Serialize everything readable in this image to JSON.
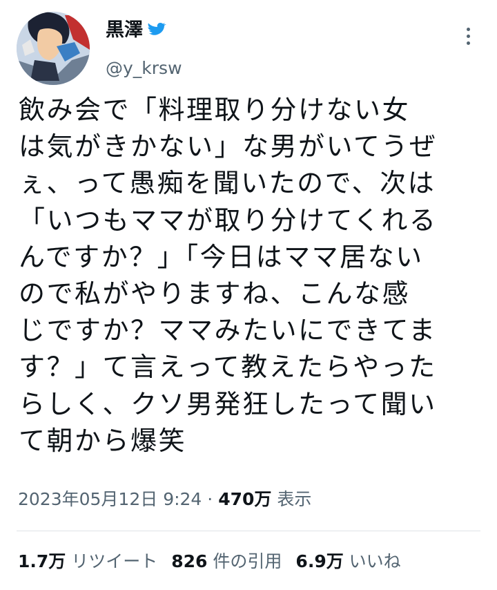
{
  "user": {
    "display_name": "黒澤",
    "badge_icon": "bird-icon",
    "handle": "@y_krsw"
  },
  "tweet": {
    "lines": [
      "飲み会で「料理取り分けない女",
      "は気がきかない」な男がいてうぜ",
      "ぇ、って愚痴を聞いたので、次は",
      "「いつもママが取り分けてくれる",
      "んですか？」「今日はママ居ない",
      "ので私がやりますね、こんな感",
      "じですか？ママみたいにできてま",
      "す？」て言えって教えたらやった",
      "らしく、クソ男発狂したって聞い",
      "て朝から爆笑"
    ],
    "timestamp": "2023年05月12日 9:24",
    "separator": "·",
    "views_count": "470万",
    "views_label": "表示"
  },
  "stats": {
    "retweets_count": "1.7万",
    "retweets_label": "リツイート",
    "quotes_count": "826",
    "quotes_label": "件の引用",
    "likes_count": "6.9万",
    "likes_label": "いいね"
  },
  "colors": {
    "text": "#0f1419",
    "secondary": "#536471",
    "accent": "#1d9bf0",
    "divider": "#dfe3e7"
  }
}
